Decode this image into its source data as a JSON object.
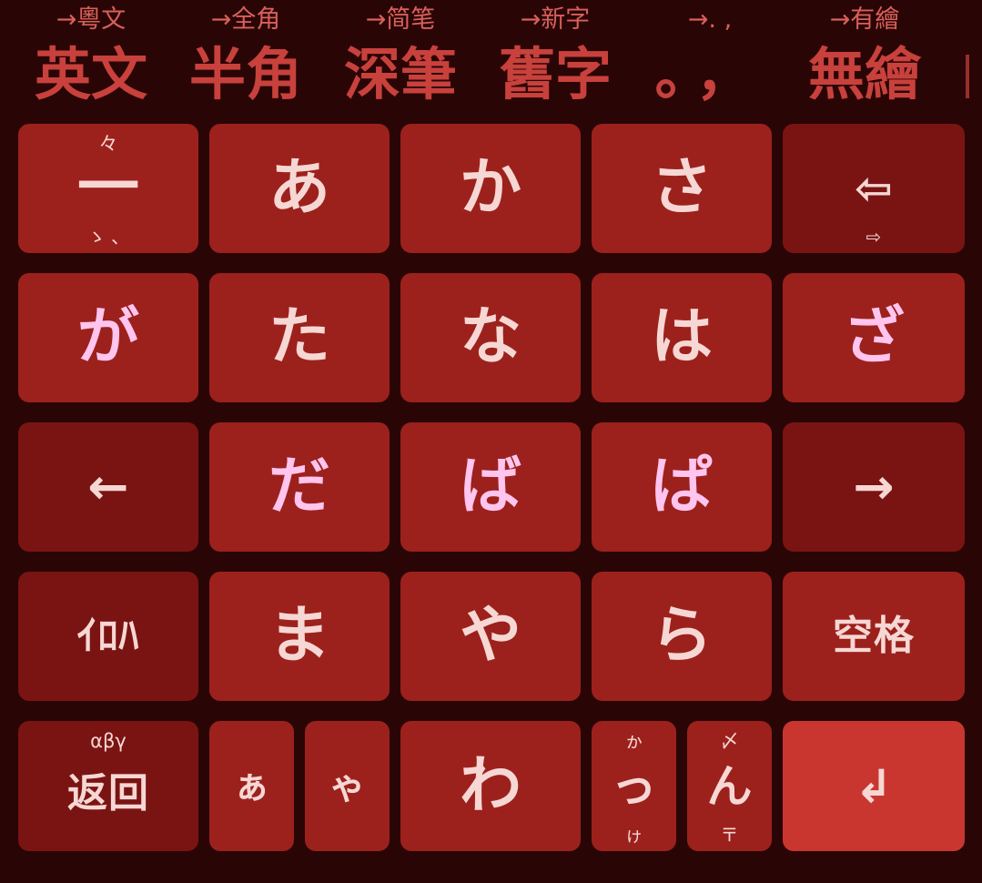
{
  "candidates": [
    {
      "hint": "→粵文",
      "main": "英文"
    },
    {
      "hint": "→全角",
      "main": "半角"
    },
    {
      "hint": "→简笔",
      "main": "深筆"
    },
    {
      "hint": "→新字",
      "main": "舊字"
    },
    {
      "hint": "→. ,",
      "main": "。，"
    },
    {
      "hint": "→有繪",
      "main": "無繪"
    }
  ],
  "keys": {
    "r1": [
      {
        "main": "一",
        "top": "々",
        "bottom": "ゝ 、"
      },
      {
        "main": "あ"
      },
      {
        "main": "か"
      },
      {
        "main": "さ"
      },
      {
        "main": "⇦",
        "bottom": "⇨"
      }
    ],
    "r2": [
      {
        "main": "が"
      },
      {
        "main": "た"
      },
      {
        "main": "な"
      },
      {
        "main": "は"
      },
      {
        "main": "ざ"
      }
    ],
    "r3": [
      {
        "main": "←"
      },
      {
        "main": "だ"
      },
      {
        "main": "ば"
      },
      {
        "main": "ぱ"
      },
      {
        "main": "→"
      }
    ],
    "r4": [
      {
        "main": "ｲﾛﾊ"
      },
      {
        "main": "ま"
      },
      {
        "main": "や"
      },
      {
        "main": "ら"
      },
      {
        "main": "空格"
      }
    ],
    "r5": [
      {
        "main": "返回",
        "top": "αβγ"
      },
      {
        "main": "ぁ"
      },
      {
        "main": "ゃ"
      },
      {
        "main": "わ"
      },
      {
        "main": "っ",
        "top": "ゕ",
        "bottom": "ゖ"
      },
      {
        "main": "ん",
        "top": "〆",
        "bottom": "〒"
      },
      {
        "main": "↲"
      }
    ]
  },
  "colors": {
    "background": "#2a0506",
    "key": "#9c211c",
    "key_dark": "#7a1412",
    "enter": "#c9362f",
    "candidate_text": "#c8413c",
    "key_text": "#f6d7d4",
    "dakuten_text": "#ffc5ef"
  }
}
